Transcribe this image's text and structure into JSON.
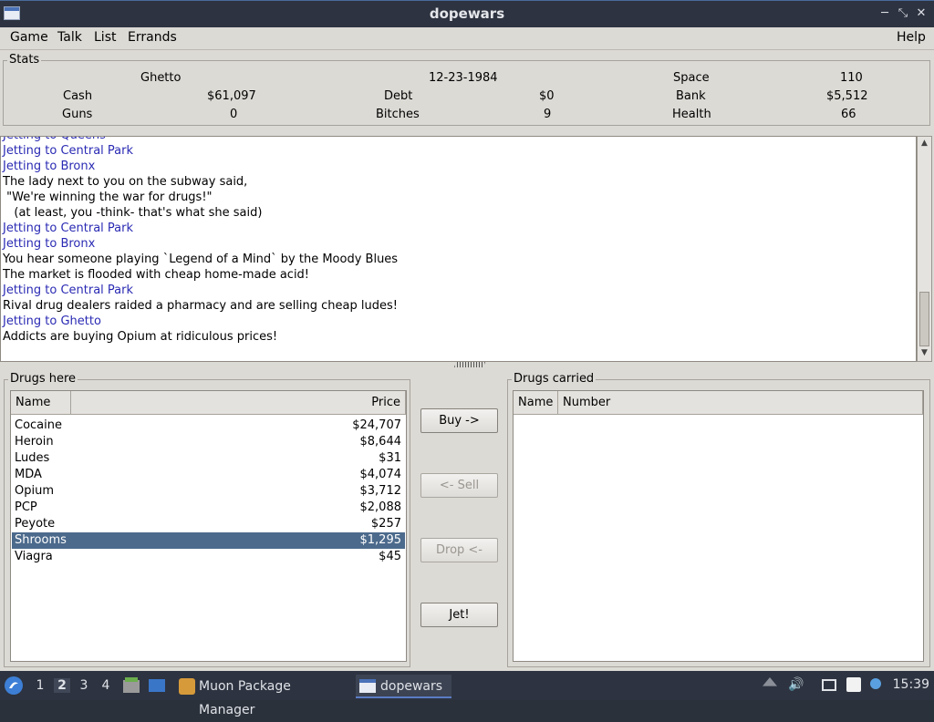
{
  "window": {
    "title": "dopewars"
  },
  "menu": [
    {
      "label": "Game"
    },
    {
      "label": "Talk"
    },
    {
      "label": "List"
    },
    {
      "label": "Errands"
    },
    {
      "label": "Help"
    }
  ],
  "stats": {
    "label": "Stats",
    "location": "Ghetto",
    "date": "12-23-1984",
    "space_label": "Space",
    "space": "110",
    "cash_label": "Cash",
    "cash": "$61,097",
    "debt_label": "Debt",
    "debt": "$0",
    "bank_label": "Bank",
    "bank": "$5,512",
    "guns_label": "Guns",
    "guns": "0",
    "bitches_label": "Bitches",
    "bitches": "9",
    "health_label": "Health",
    "health": "66"
  },
  "messages": [
    {
      "text": "Jetting to Queens",
      "jet": true
    },
    {
      "text": "Jetting to Central Park",
      "jet": true
    },
    {
      "text": "Jetting to Bronx",
      "jet": true
    },
    {
      "text": "The lady next to you on the subway said,",
      "jet": false
    },
    {
      "text": " \"We're winning the war for drugs!\"",
      "jet": false
    },
    {
      "text": "   (at least, you -think- that's what she said)",
      "jet": false
    },
    {
      "text": "Jetting to Central Park",
      "jet": true
    },
    {
      "text": "Jetting to Bronx",
      "jet": true
    },
    {
      "text": "You hear someone playing `Legend of a Mind` by the Moody Blues",
      "jet": false
    },
    {
      "text": "The market is flooded with cheap home-made acid!",
      "jet": false
    },
    {
      "text": "Jetting to Central Park",
      "jet": true
    },
    {
      "text": "Rival drug dealers raided a pharmacy and are selling cheap ludes!",
      "jet": false
    },
    {
      "text": "Jetting to Ghetto",
      "jet": true
    },
    {
      "text": "Addicts are buying Opium at ridiculous prices!",
      "jet": false
    }
  ],
  "drugs_here": {
    "label": "Drugs here",
    "col_name": "Name",
    "col_price": "Price",
    "rows": [
      {
        "name": "Cocaine",
        "price": "$24,707"
      },
      {
        "name": "Heroin",
        "price": "$8,644"
      },
      {
        "name": "Ludes",
        "price": "$31"
      },
      {
        "name": "MDA",
        "price": "$4,074"
      },
      {
        "name": "Opium",
        "price": "$3,712"
      },
      {
        "name": "PCP",
        "price": "$2,088"
      },
      {
        "name": "Peyote",
        "price": "$257"
      },
      {
        "name": "Shrooms",
        "price": "$1,295",
        "selected": true
      },
      {
        "name": "Viagra",
        "price": "$45"
      }
    ]
  },
  "drugs_carried": {
    "label": "Drugs carried",
    "col_name": "Name",
    "col_number": "Number"
  },
  "buttons": {
    "buy": "Buy ->",
    "sell": "<- Sell",
    "drop": "Drop <-",
    "jet": "Jet!"
  },
  "taskbar": {
    "workspaces": [
      "1",
      "2",
      "3",
      "4"
    ],
    "active_workspace": "2",
    "tasks": [
      {
        "label": "Muon Package Manager"
      },
      {
        "label": "dopewars"
      }
    ],
    "clock": "15:39"
  },
  "colors": {
    "selection": "#4c6a8c",
    "jet_text": "#2a2ab4",
    "titlebar": "#2d3340"
  }
}
